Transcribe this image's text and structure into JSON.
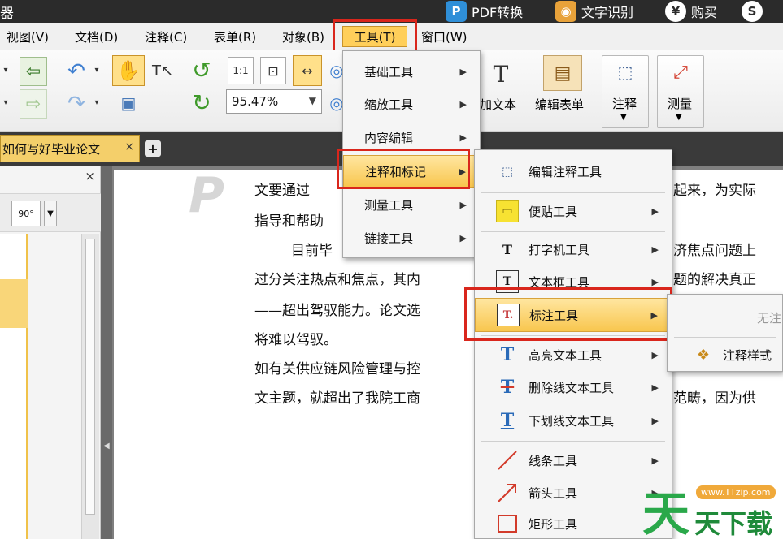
{
  "titlebar": {
    "app_title": "器",
    "pdf_convert": "PDF转换",
    "ocr": "文字识别",
    "buy": "购买",
    "pdf_icon_letter": "P",
    "buy_icon": "¥",
    "user_icon": "S"
  },
  "menubar": {
    "items": [
      "视图(V)",
      "文档(D)",
      "注释(C)",
      "表单(R)",
      "对象(B)",
      "工具(T)",
      "窗口(W)"
    ]
  },
  "toolbar": {
    "zoom_value": "95.47%",
    "fit_label": "1:1",
    "add_text": "加文本",
    "edit_form": "编辑表单",
    "annotate": "注释",
    "measure": "测量",
    "rotate_label": "90°"
  },
  "tab": {
    "title": "如何写好毕业论文",
    "close": "×",
    "add": "+"
  },
  "panel": {
    "close": "×"
  },
  "document": {
    "lines": [
      "文要通过",
      "指导和帮助",
      "目前毕",
      "过分关注热点和焦点，其内",
      "——超出驾驭能力。论文选",
      "将难以驾驭。",
      "如有关供应链风险管理与控",
      "文主题，就超出了我院工商"
    ],
    "right_lines": [
      "起来，为实际",
      "济焦点问题上",
      "题的解决真正",
      "范畴，因为供"
    ]
  },
  "tools_menu": {
    "items": [
      "基础工具",
      "缩放工具",
      "内容编辑",
      "注释和标记",
      "测量工具",
      "链接工具"
    ]
  },
  "annot_menu": {
    "items": [
      "编辑注释工具",
      "便贴工具",
      "打字机工具",
      "文本框工具",
      "标注工具",
      "高亮文本工具",
      "删除线文本工具",
      "下划线文本工具",
      "线条工具",
      "箭头工具",
      "矩形工具"
    ]
  },
  "callout_menu": {
    "disabled": "无注",
    "style": "注释样式"
  },
  "logo": {
    "site": "www.TTzip.com",
    "big": "天",
    "text": "天下载"
  },
  "colors": {
    "highlight": "#f8c64e",
    "red_box": "#d9261c",
    "titlebar": "#2b2b2b"
  }
}
